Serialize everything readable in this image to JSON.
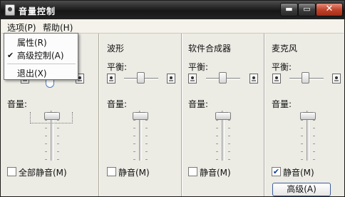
{
  "window": {
    "title": "音量控制"
  },
  "titlebar_buttons": {
    "minimize": "▬",
    "maximize": "▭",
    "close": "✕"
  },
  "menubar": [
    {
      "label": "选项(P)"
    },
    {
      "label": "帮助(H)"
    }
  ],
  "dropdown": {
    "items": [
      {
        "label": "属性(R)",
        "checked": false
      },
      {
        "label": "高级控制(A)",
        "checked": true
      },
      {
        "label": "退出(X)",
        "checked": false
      }
    ],
    "check_glyph": "✔"
  },
  "columns": [
    {
      "title": "",
      "balance_label": "",
      "volume_label": "音量:",
      "mute_label": "全部静音(M)",
      "mute_checked": false
    },
    {
      "title": "波形",
      "balance_label": "平衡:",
      "volume_label": "音量:",
      "mute_label": "静音(M)",
      "mute_checked": false
    },
    {
      "title": "软件合成器",
      "balance_label": "平衡:",
      "volume_label": "音量:",
      "mute_label": "静音(M)",
      "mute_checked": false
    },
    {
      "title": "麦克风",
      "balance_label": "平衡:",
      "volume_label": "音量:",
      "mute_label": "静音(M)",
      "mute_checked": true
    }
  ],
  "advanced_button": {
    "label": "高级(A)"
  },
  "icons": {
    "speaker": "speaker-icon",
    "app": "volume-app-icon"
  }
}
